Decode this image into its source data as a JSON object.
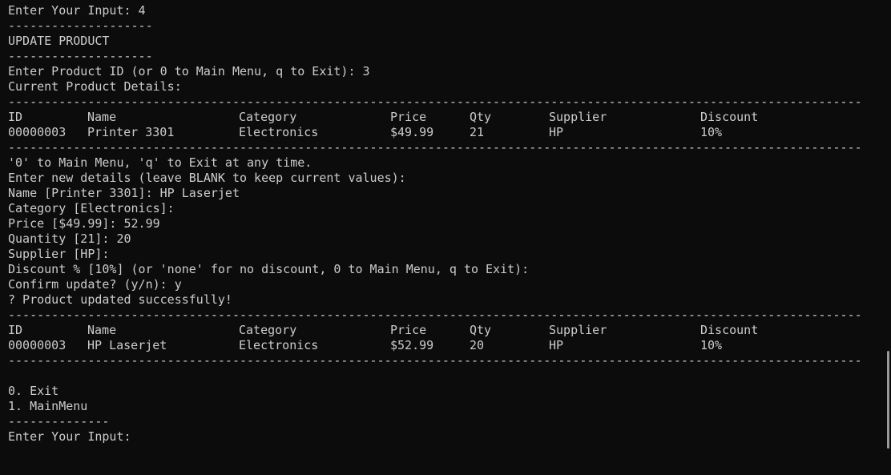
{
  "lines_top": [
    "Enter Your Input: 4",
    "--------------------",
    "UPDATE PRODUCT",
    "--------------------",
    "Enter Product ID (or 0 to Main Menu, q to Exit): 3",
    "Current Product Details:"
  ],
  "separator_long": "----------------------------------------------------------------------------------------------------------------------",
  "table1": {
    "header": {
      "id": "ID",
      "name": "Name",
      "category": "Category",
      "price": "Price",
      "qty": "Qty",
      "supplier": "Supplier",
      "discount": "Discount"
    },
    "row": {
      "id": "00000003",
      "name": "Printer 3301",
      "category": "Electronics",
      "price": "$49.99",
      "qty": "21",
      "supplier": "HP",
      "discount": "10%"
    }
  },
  "lines_mid": [
    "'0' to Main Menu, 'q' to Exit at any time.",
    "Enter new details (leave BLANK to keep current values):",
    "Name [Printer 3301]: HP Laserjet",
    "Category [Electronics]:",
    "Price [$49.99]: 52.99",
    "Quantity [21]: 20",
    "Supplier [HP]:",
    "Discount % [10%] (or 'none' for no discount, 0 to Main Menu, q to Exit):",
    "Confirm update? (y/n): y",
    "? Product updated successfully!"
  ],
  "table2": {
    "header": {
      "id": "ID",
      "name": "Name",
      "category": "Category",
      "price": "Price",
      "qty": "Qty",
      "supplier": "Supplier",
      "discount": "Discount"
    },
    "row": {
      "id": "00000003",
      "name": "HP Laserjet",
      "category": "Electronics",
      "price": "$52.99",
      "qty": "20",
      "supplier": "HP",
      "discount": "10%"
    }
  },
  "menu": {
    "blank": "",
    "exit": "0. Exit",
    "main_menu": "1. MainMenu",
    "separator_short": "--------------",
    "prompt": "Enter Your Input:"
  }
}
